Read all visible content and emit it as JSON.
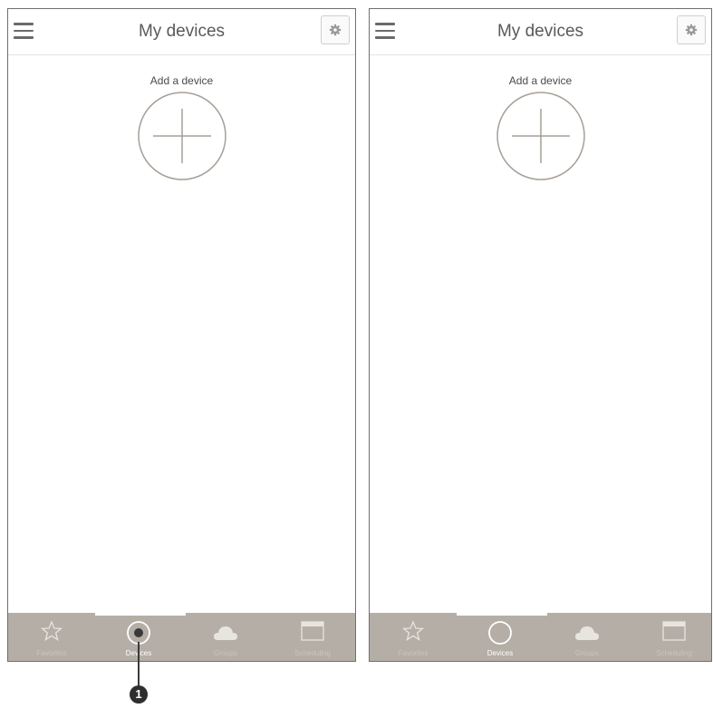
{
  "screens": [
    {
      "title": "My devices",
      "add_label": "Add a device",
      "tabs": [
        {
          "label": "Favorites",
          "icon": "star-icon"
        },
        {
          "label": "Devices",
          "icon": "circle-icon"
        },
        {
          "label": "Groups",
          "icon": "cloud-icon"
        },
        {
          "label": "Scheduling",
          "icon": "calendar-icon"
        }
      ],
      "active_tab": "Devices"
    },
    {
      "title": "My devices",
      "add_label": "Add a device",
      "tabs": [
        {
          "label": "Favorites",
          "icon": "star-icon"
        },
        {
          "label": "Devices",
          "icon": "circle-icon"
        },
        {
          "label": "Groups",
          "icon": "cloud-icon"
        },
        {
          "label": "Scheduling",
          "icon": "calendar-icon"
        }
      ],
      "active_tab": "Devices"
    }
  ],
  "callout": {
    "number": "1"
  },
  "colors": {
    "tabbar": "#b4aea6",
    "border": "#6f6f6f",
    "text": "#5a5a5a"
  }
}
